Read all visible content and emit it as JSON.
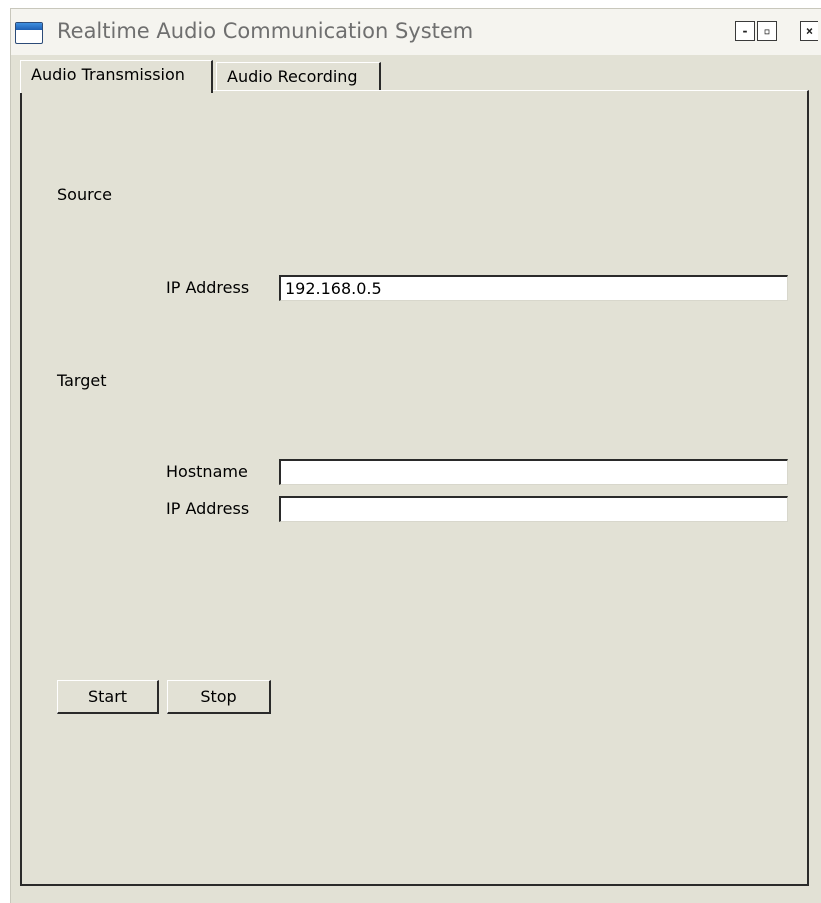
{
  "window": {
    "title": "Realtime Audio Communication System",
    "controls": {
      "minimize": "-",
      "maximize": "▫",
      "close": "×"
    }
  },
  "tabs": [
    {
      "label": "Audio Transmission",
      "active": true
    },
    {
      "label": "Audio Recording",
      "active": false
    }
  ],
  "source": {
    "section_label": "Source",
    "ip_label": "IP Address",
    "ip_value": "192.168.0.5"
  },
  "target": {
    "section_label": "Target",
    "hostname_label": "Hostname",
    "hostname_value": "",
    "ip_label": "IP Address",
    "ip_value": ""
  },
  "actions": {
    "start_label": "Start",
    "stop_label": "Stop"
  }
}
